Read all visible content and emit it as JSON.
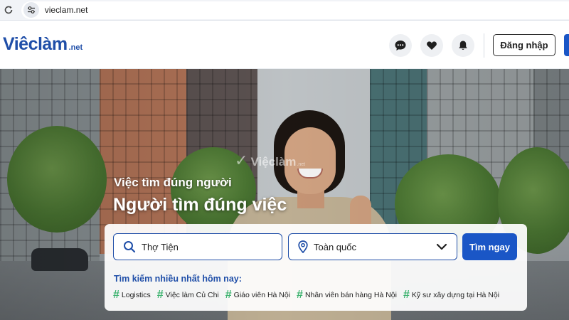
{
  "browser": {
    "url": "vieclam.net",
    "reload_icon": "reload-icon",
    "site_settings_icon": "tune-icon"
  },
  "header": {
    "logo_main": "Viêclàm",
    "logo_suffix": ".net",
    "icons": [
      "chat-icon",
      "heart-icon",
      "bell-icon"
    ],
    "login_label": "Đăng nhập"
  },
  "hero": {
    "watermark_text": "Việclàm",
    "watermark_suffix": ".net",
    "tagline_small": "Việc tìm đúng người",
    "tagline_large": "Người tìm đúng việc"
  },
  "search": {
    "keyword_value": "Thợ Tiện",
    "location_value": "Toàn quốc",
    "button_label": "Tìm ngay",
    "popular_title": "Tìm kiếm nhiều nhất hôm nay:",
    "tags": [
      "Logistics",
      "Việc làm Củ Chi",
      "Giáo viên Hà Nội",
      "Nhân viên bán hàng Hà Nội",
      "Kỹ sư xây dựng tại Hà Nội"
    ]
  },
  "colors": {
    "brand": "#1f4ea8",
    "primary_button": "#1a56c6",
    "tag_hash": "#3bb26e"
  }
}
